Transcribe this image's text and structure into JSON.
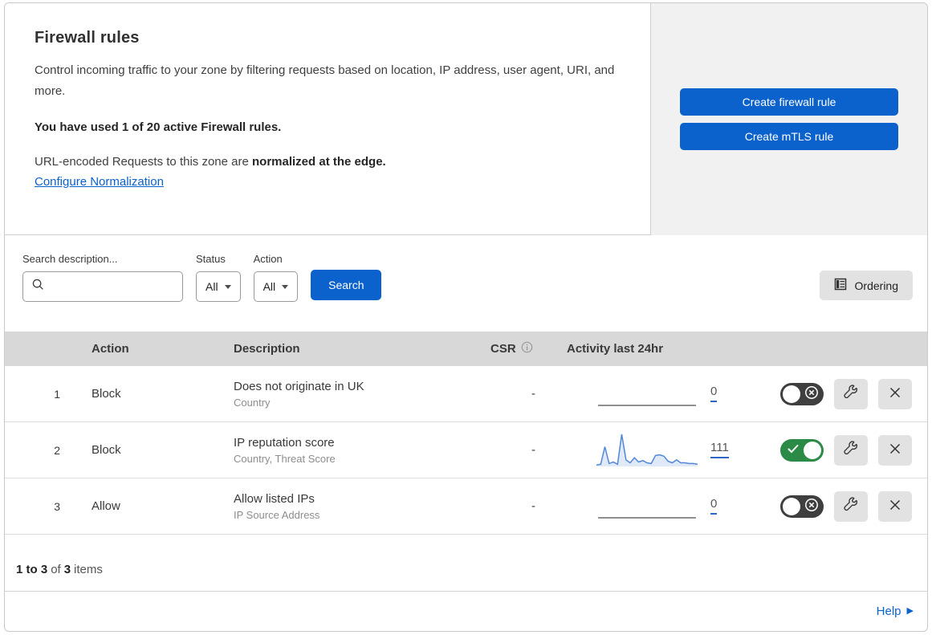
{
  "header": {
    "title": "Firewall rules",
    "description": "Control incoming traffic to your zone by filtering requests based on location, IP address, user agent, URI, and more.",
    "usage": "You have used 1 of 20 active Firewall rules.",
    "normalization_prefix": "URL-encoded Requests to this zone are ",
    "normalization_bold": "normalized at the edge.",
    "normalization_link": "Configure Normalization",
    "create_firewall_button": "Create firewall rule",
    "create_mtls_button": "Create mTLS rule"
  },
  "filters": {
    "search_label": "Search description...",
    "status_label": "Status",
    "status_value": "All",
    "action_label": "Action",
    "action_value": "All",
    "search_button": "Search",
    "ordering_button": "Ordering"
  },
  "table": {
    "columns": {
      "action": "Action",
      "description": "Description",
      "csr": "CSR",
      "activity": "Activity last 24hr"
    },
    "rows": [
      {
        "priority": "1",
        "action": "Block",
        "description": "Does not originate in UK",
        "criteria": "Country",
        "csr": "-",
        "activity_count": "0",
        "enabled": false,
        "sparkline": []
      },
      {
        "priority": "2",
        "action": "Block",
        "description": "IP reputation score",
        "criteria": "Country, Threat Score",
        "csr": "-",
        "activity_count": "111",
        "enabled": true,
        "sparkline": [
          2,
          3,
          27,
          4,
          6,
          3,
          44,
          9,
          5,
          12,
          6,
          8,
          5,
          4,
          15,
          16,
          14,
          7,
          5,
          9,
          5,
          5,
          4,
          4,
          3
        ]
      },
      {
        "priority": "3",
        "action": "Allow",
        "description": "Allow listed IPs",
        "criteria": "IP Source Address",
        "csr": "-",
        "activity_count": "0",
        "enabled": false,
        "sparkline": []
      }
    ]
  },
  "footer": {
    "range": "1 to 3",
    "of": "of",
    "total": "3",
    "items": "items",
    "help": "Help",
    "help_arrow": "▶"
  },
  "icons": {
    "search_icon": "magnifier",
    "ordering_icon": "list-document",
    "csr_info_icon": "info-circle",
    "toggle_off_icon": "x-circle",
    "toggle_on_icon": "checkmark",
    "edit_icon": "wrench",
    "delete_icon": "x"
  },
  "colors": {
    "accent_blue": "#0c62cc",
    "link_blue": "#0c62cc",
    "toggle_on_green": "#2c8a47",
    "toggle_off_gray": "#3f3f3f",
    "sparkline_blue": "#5187d7",
    "sparkline_fill": "#dfe9f8",
    "table_header_gray": "#d8d8d8",
    "side_panel_gray": "#f1f1f1"
  }
}
